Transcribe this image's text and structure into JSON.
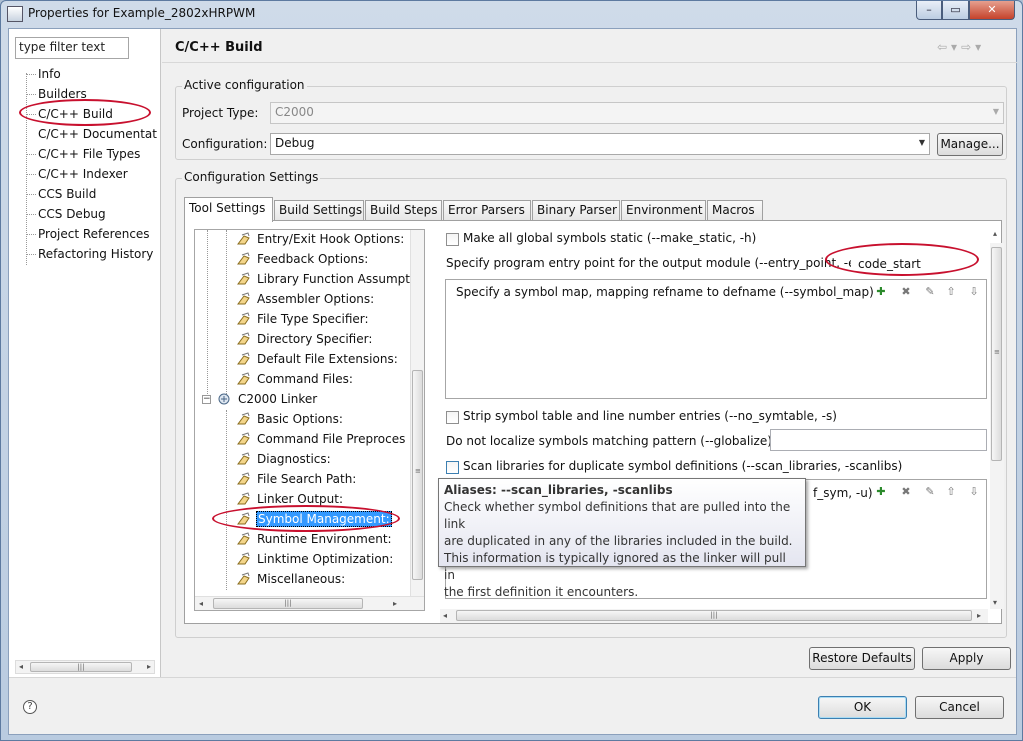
{
  "window": {
    "title": "Properties for Example_2802xHRPWM",
    "controls": {
      "minimize": "–",
      "maximize": "▭",
      "close": "✕"
    }
  },
  "filter": {
    "text": "type filter text"
  },
  "nav": {
    "items": [
      {
        "label": "Info"
      },
      {
        "label": "Builders"
      },
      {
        "label": "C/C++ Build"
      },
      {
        "label": "C/C++ Documentation"
      },
      {
        "label": "C/C++ File Types"
      },
      {
        "label": "C/C++ Indexer"
      },
      {
        "label": "CCS Build"
      },
      {
        "label": "CCS Debug"
      },
      {
        "label": "Project References"
      },
      {
        "label": "Refactoring History"
      }
    ]
  },
  "page": {
    "title": "C/C++ Build"
  },
  "active_config": {
    "group_label": "Active configuration",
    "project_type_label": "Project Type:",
    "project_type_value": "C2000",
    "configuration_label": "Configuration:",
    "configuration_value": "Debug",
    "manage_label": "Manage..."
  },
  "config_settings": {
    "group_label": "Configuration Settings"
  },
  "tabs": [
    {
      "label": "Tool Settings"
    },
    {
      "label": "Build Settings"
    },
    {
      "label": "Build Steps"
    },
    {
      "label": "Error Parsers"
    },
    {
      "label": "Binary Parser"
    },
    {
      "label": "Environment"
    },
    {
      "label": "Macros"
    }
  ],
  "tool_tree": {
    "items": [
      "Entry/Exit Hook Options:",
      "Feedback Options:",
      "Library Function Assumpti",
      "Assembler Options:",
      "File Type Specifier:",
      "Directory Specifier:",
      "Default File Extensions:",
      "Command Files:",
      "C2000 Linker",
      "Basic Options:",
      "Command File Preproces",
      "Diagnostics:",
      "File Search Path:",
      "Linker Output:",
      "Symbol Management:",
      "Runtime Environment:",
      "Linktime Optimization:",
      "Miscellaneous:"
    ]
  },
  "settings": {
    "make_static_label": "Make all global symbols static (--make_static, -h)",
    "entry_point_label": "Specify program entry point for the output module (--entry_point, -e)",
    "entry_point_value": "code_start",
    "symbol_map_label": "Specify a symbol map, mapping refname to defname (--symbol_map)",
    "strip_label": "Strip symbol table and line number entries (--no_symtable, -s)",
    "globalize_label": "Do not localize symbols matching pattern (--globalize)",
    "globalize_value": "",
    "scan_libs_label": "Scan libraries for duplicate symbol definitions (--scan_libraries, -scanlibs)",
    "undef_label_fragment": "f_sym, -u)"
  },
  "tooltip": {
    "alias_prefix": "Aliases: ",
    "alias_value": "--scan_libraries, -scanlibs",
    "lines": [
      "Check whether symbol definitions that are pulled into the link",
      "are duplicated in any of the libraries included in the build.",
      "This information is typically ignored as the linker will pull in",
      "the first definition it encounters."
    ]
  },
  "buttons": {
    "restore_defaults": "Restore Defaults",
    "apply": "Apply",
    "ok": "OK",
    "cancel": "Cancel"
  },
  "icons": {
    "help": "?",
    "scroll_grip_v": "≡",
    "scroll_grip_h": "|||"
  },
  "colors": {
    "annotation_oval": "#c8102e",
    "selection": "#3399ff"
  }
}
